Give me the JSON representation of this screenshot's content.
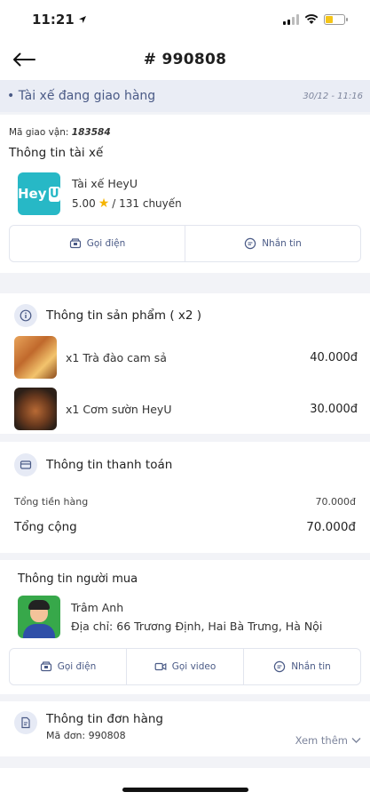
{
  "status_bar": {
    "time": "11:21"
  },
  "header": {
    "title": "# 990808"
  },
  "delivery_status": {
    "label": "• Tài xế đang giao hàng",
    "time": "30/12 - 11:16"
  },
  "driver": {
    "tracking_label": "Mã giao vận:",
    "tracking_code": "183584",
    "section_title": "Thông tin tài xế",
    "logo_text": "Hey",
    "logo_u": "U",
    "name": "Tài xế HeyU",
    "rating": "5.00",
    "trips": "/ 131 chuyến",
    "call_label": "Gọi điện",
    "message_label": "Nhắn tin"
  },
  "products": {
    "title": "Thông tin sản phẩm ( x2 )",
    "items": [
      {
        "name": "x1 Trà đào cam sả",
        "price": "40.000đ"
      },
      {
        "name": "x1 Cơm sườn HeyU",
        "price": "30.000đ"
      }
    ]
  },
  "payment": {
    "title": "Thông tin thanh toán",
    "subtotal_label": "Tổng tiền hàng",
    "subtotal_value": "70.000đ",
    "total_label": "Tổng cộng",
    "total_value": "70.000đ"
  },
  "buyer": {
    "section_title": "Thông tin người mua",
    "name": "Trâm Anh",
    "address": "Địa chỉ: 66 Trương Định, Hai Bà Trưng, Hà Nội",
    "call_label": "Gọi điện",
    "video_label": "Gọi video",
    "message_label": "Nhắn tin"
  },
  "order": {
    "title": "Thông tin đơn hàng",
    "code": "Mã đơn: 990808",
    "see_more": "Xem thêm"
  },
  "colors": {
    "accent": "#4a5a86",
    "status_bg": "#eaedf5",
    "heyu": "#27b8c6",
    "star": "#f5b400"
  }
}
